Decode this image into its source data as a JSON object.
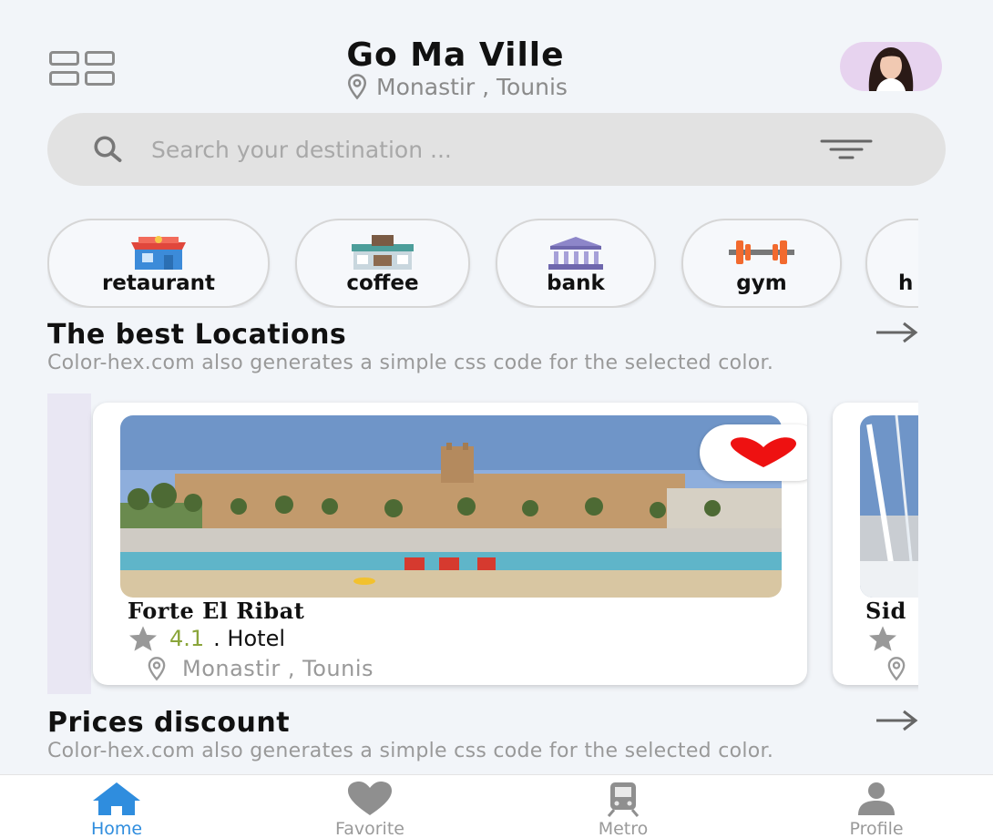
{
  "header": {
    "title": "Go Ma Ville",
    "location": "Monastir , Tounis",
    "menu_icon": "grid-menu-icon",
    "avatar": "user-avatar"
  },
  "search": {
    "placeholder": "Search your destination ...",
    "value": "",
    "icon": "search-icon",
    "filter_icon": "filter-icon"
  },
  "categories": [
    {
      "label": "retaurant",
      "icon": "restaurant-icon"
    },
    {
      "label": "coffee",
      "icon": "coffee-shop-icon"
    },
    {
      "label": "bank",
      "icon": "bank-icon"
    },
    {
      "label": "gym",
      "icon": "dumbbell-icon"
    },
    {
      "label": "h",
      "icon": "hotel-icon"
    }
  ],
  "best_locations": {
    "title": "The best Locations",
    "description": "Color-hex.com also generates a simple css code for the selected color.",
    "cards": [
      {
        "name": "Forte El Ribat",
        "rating": "4.1",
        "type": ". Hotel",
        "location": "Monastir , Tounis",
        "favorite": true
      },
      {
        "name": "Sid",
        "rating": "",
        "type": "",
        "location": "",
        "favorite": false
      }
    ]
  },
  "prices_discount": {
    "title": "Prices discount",
    "description": "Color-hex.com also generates a simple css code for the selected color."
  },
  "bottom_nav": [
    {
      "label": "Home",
      "icon": "home-icon",
      "active": true
    },
    {
      "label": "Favorite",
      "icon": "heart-icon",
      "active": false
    },
    {
      "label": "Metro",
      "icon": "train-icon",
      "active": false
    },
    {
      "label": "Profile",
      "icon": "person-icon",
      "active": false
    }
  ],
  "colors": {
    "background": "#f2f5f9",
    "accent": "#2f8dde",
    "rating": "#8aa53a",
    "favorite_heart": "#ee1111",
    "search_bg": "#e2e2e2"
  }
}
